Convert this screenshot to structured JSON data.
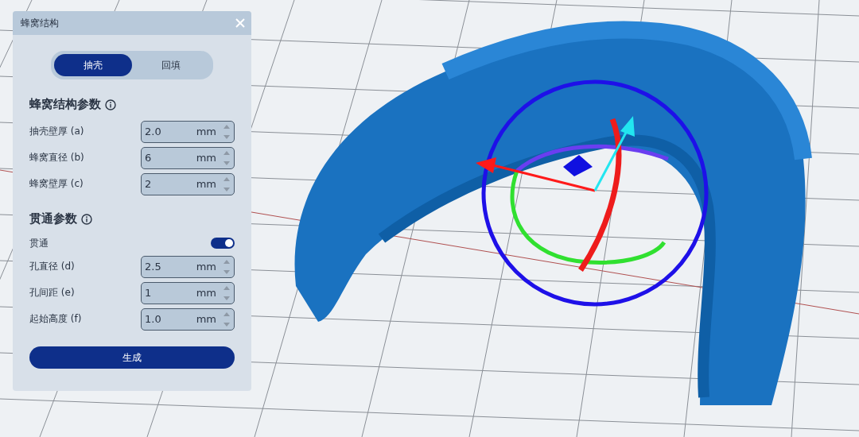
{
  "panel": {
    "title": "蜂窝结构",
    "modes": [
      {
        "label": "抽壳",
        "selected": true
      },
      {
        "label": "回填",
        "selected": false
      }
    ],
    "sections": [
      {
        "title": "蜂窝结构参数",
        "rows": [
          {
            "kind": "number",
            "label": "抽壳壁厚 (a)",
            "value": "2.0",
            "unit": "mm"
          },
          {
            "kind": "number",
            "label": "蜂窝直径 (b)",
            "value": "6",
            "unit": "mm"
          },
          {
            "kind": "number",
            "label": "蜂窝壁厚 (c)",
            "value": "2",
            "unit": "mm"
          }
        ]
      },
      {
        "title": "贯通参数",
        "rows": [
          {
            "kind": "toggle",
            "label": "贯通",
            "on": true
          },
          {
            "kind": "number",
            "label": "孔直径 (d)",
            "value": "2.5",
            "unit": "mm"
          },
          {
            "kind": "number",
            "label": "孔间距 (e)",
            "value": "1",
            "unit": "mm"
          },
          {
            "kind": "number",
            "label": "起始高度 (f)",
            "value": "1.0",
            "unit": "mm"
          }
        ]
      }
    ],
    "generate_button": "生成"
  }
}
